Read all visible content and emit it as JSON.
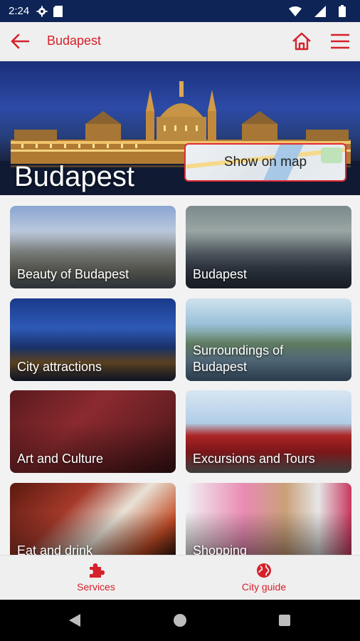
{
  "status_bar": {
    "time": "2:24",
    "icons": [
      "gear-icon",
      "sd-card-icon",
      "wifi-icon",
      "signal-icon",
      "battery-icon"
    ]
  },
  "app_bar": {
    "title": "Budapest",
    "back_icon": "arrow-left-icon",
    "home_icon": "home-icon",
    "menu_icon": "hamburger-menu-icon"
  },
  "hero": {
    "title": "Budapest",
    "map_button_label": "Show on map"
  },
  "categories": [
    {
      "label": "Beauty of Budapest"
    },
    {
      "label": "Budapest"
    },
    {
      "label": "City attractions"
    },
    {
      "label": "Surroundings of Budapest"
    },
    {
      "label": "Art and Culture"
    },
    {
      "label": "Excursions and Tours"
    },
    {
      "label": "Eat and drink"
    },
    {
      "label": "Shopping"
    }
  ],
  "bottom_nav": {
    "services_label": "Services",
    "city_guide_label": "City guide"
  },
  "colors": {
    "accent": "#d6202a",
    "status_bar": "#0e2456",
    "background": "#f2f2f2"
  }
}
